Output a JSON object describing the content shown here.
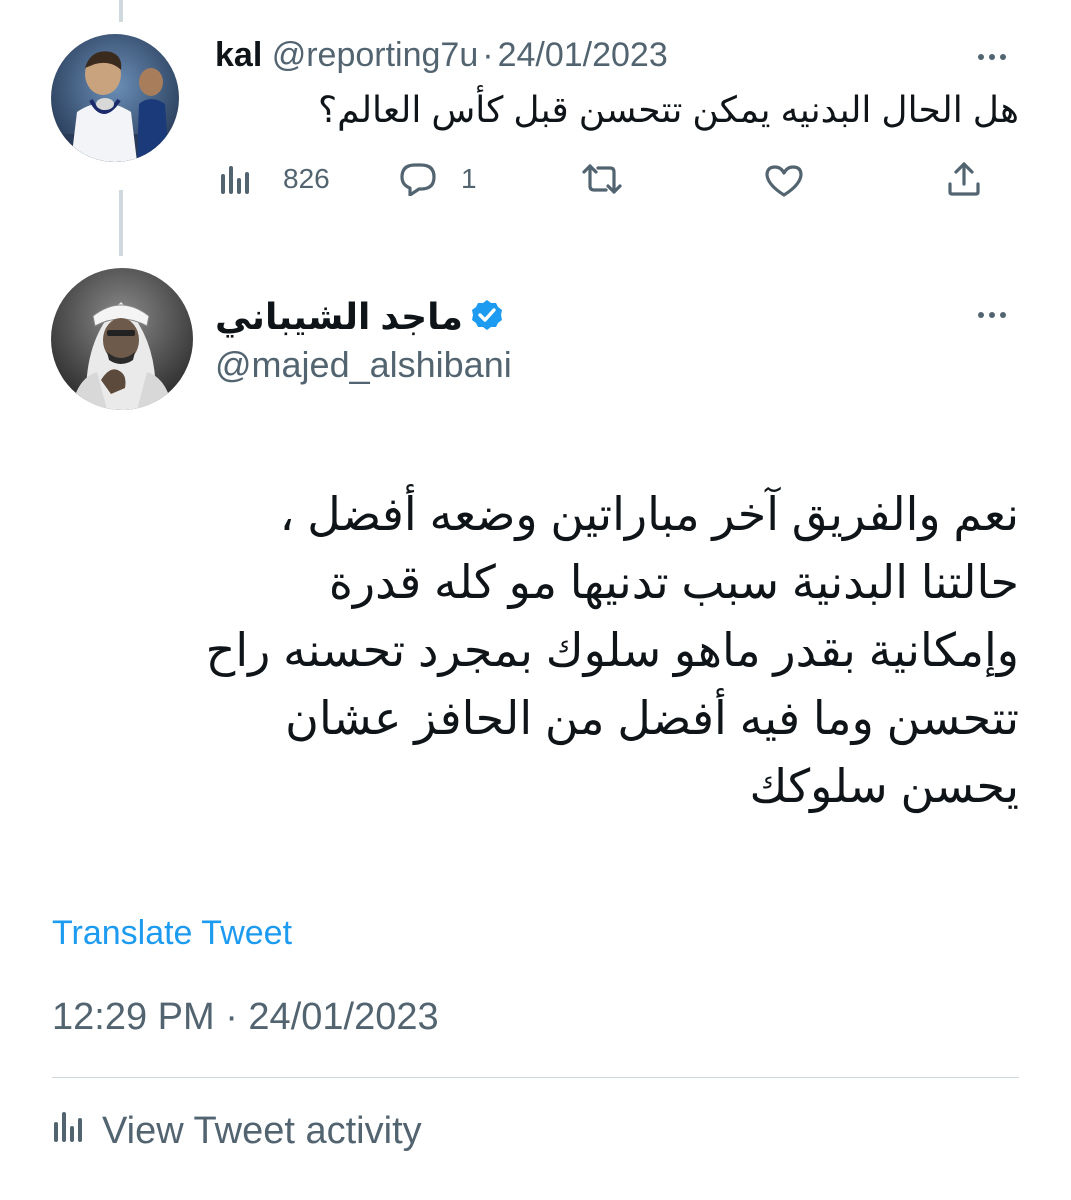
{
  "reply_tweet": {
    "display_name": "kal",
    "handle": "@reporting7u",
    "separator": "·",
    "date": "24/01/2023",
    "text": "هل الحال البدنيه يمكن تتحسن قبل كأس العالم؟",
    "views_count": "826",
    "replies_count": "1",
    "icons": {
      "views": "bar-chart-icon",
      "reply": "speech-bubble-icon",
      "retweet": "retweet-icon",
      "like": "heart-icon",
      "share": "share-upload-icon",
      "more": "ellipsis-icon"
    }
  },
  "main_tweet": {
    "display_name": "ماجد الشيباني",
    "handle": "@majed_alshibani",
    "verified": true,
    "text_lines": [
      "نعم والفريق آخر مباراتين وضعه أفضل ،",
      "حالتنا البدنية سبب تدنيها مو كله قدرة",
      "وإمكانية بقدر ماهو سلوك بمجرد تحسنه راح",
      "تتحسن وما فيه أفضل من الحافز عشان",
      "يحسن سلوكك"
    ],
    "translate_label": "Translate Tweet",
    "timestamp": "12:29 PM · 24/01/2023",
    "activity_label": "View Tweet activity"
  },
  "colors": {
    "accent": "#1d9bf0",
    "muted": "#536471",
    "text": "#0f1419",
    "divider": "#cfd9de"
  }
}
